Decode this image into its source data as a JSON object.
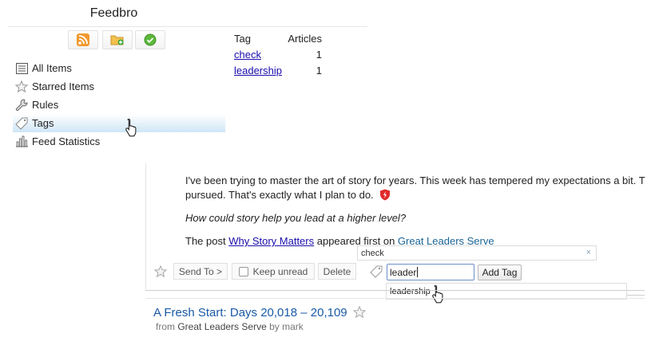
{
  "app": {
    "title": "Feedbro"
  },
  "toolbar": {
    "buttons": [
      {
        "icon": "rss-icon"
      },
      {
        "icon": "add-folder-icon"
      },
      {
        "icon": "checkmark-icon"
      }
    ]
  },
  "sidebar": {
    "items": [
      {
        "label": "All Items",
        "icon": "list-icon"
      },
      {
        "label": "Starred Items",
        "icon": "star-icon"
      },
      {
        "label": "Rules",
        "icon": "wrench-icon"
      },
      {
        "label": "Tags",
        "icon": "tag-icon",
        "active": true
      },
      {
        "label": "Feed Statistics",
        "icon": "bar-chart-icon"
      }
    ]
  },
  "tags_table": {
    "headers": {
      "tag": "Tag",
      "articles": "Articles"
    },
    "rows": [
      {
        "tag": "check",
        "count": "1"
      },
      {
        "tag": "leadership",
        "count": "1"
      }
    ]
  },
  "article": {
    "line1": "I've been trying to master the art of story for years. This week has tempered my expectations a bit. T",
    "line2": "pursued. That's exactly what I plan to do.",
    "line3": "How could story help you lead at a higher level?",
    "post_prefix": "The post ",
    "post_link": "Why Story Matters",
    "post_mid": " appeared first on ",
    "post_source": "Great Leaders Serve"
  },
  "actions": {
    "send_to": "Send To >",
    "keep_unread": "Keep unread",
    "delete": "Delete",
    "add_tag": "Add Tag"
  },
  "tag_editor": {
    "existing_tag": "check",
    "remove_symbol": "×",
    "input_value": "leader",
    "suggestion": "leadership"
  },
  "next_article": {
    "title": "A Fresh Start: Days 20,018 – 20,109",
    "from_label": "from ",
    "feed": "Great Leaders Serve",
    "by_label": " by ",
    "author": "mark"
  },
  "colors": {
    "link": "#1a0dab",
    "accent": "#1a5aa6",
    "active_tab": "#cfe6f6"
  }
}
